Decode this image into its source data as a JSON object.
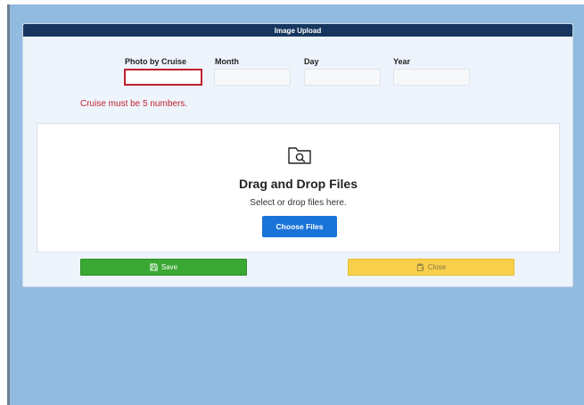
{
  "modal": {
    "title": "Image Upload"
  },
  "form": {
    "fields": [
      {
        "label": "Photo by Cruise",
        "value": "",
        "invalid": true
      },
      {
        "label": "Month",
        "value": ""
      },
      {
        "label": "Day",
        "value": ""
      },
      {
        "label": "Year",
        "value": ""
      }
    ],
    "error": "Cruise must be 5 numbers."
  },
  "dropzone": {
    "icon": "folder-search-icon",
    "title": "Drag and Drop Files",
    "subtitle": "Select or drop files here.",
    "choose_label": "Choose Files"
  },
  "actions": {
    "save_label": "Save",
    "save_icon": "floppy-disk-icon",
    "close_label": "Close",
    "close_icon": "clipboard-icon"
  },
  "colors": {
    "header": "#16365f",
    "backdrop": "#92bbe0",
    "error": "#c0202e",
    "primary": "#1a73d9",
    "save": "#3aa832",
    "close": "#f8cf4b"
  }
}
